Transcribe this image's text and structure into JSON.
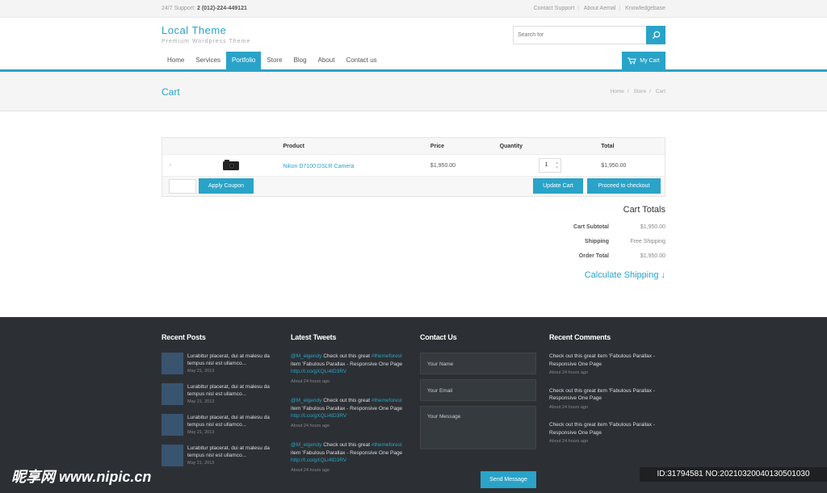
{
  "topbar": {
    "support_label": "24/7 Support:",
    "support_phone": "2 (012)-224-449121",
    "links": [
      "Contact Support",
      "About Aemal",
      "Knowledgebase"
    ]
  },
  "brand": {
    "title": "Local Theme",
    "tagline": "Premium Wordpress Theme"
  },
  "search": {
    "placeholder": "Search for"
  },
  "nav": {
    "items": [
      "Home",
      "Services",
      "Portfolio",
      "Store",
      "Blog",
      "About",
      "Contact us"
    ],
    "active": "Portfolio",
    "cart_label": "My Cart"
  },
  "page": {
    "title": "Cart",
    "breadcrumb": [
      "Home",
      "Store",
      "Cart"
    ]
  },
  "cart": {
    "headers": {
      "product": "Product",
      "price": "Price",
      "quantity": "Quantity",
      "total": "Total"
    },
    "items": [
      {
        "remove": "×",
        "product": "Nikon D7100 DSLR Camera",
        "price": "$1,950.00",
        "quantity": "1",
        "total": "$1,950.00"
      }
    ],
    "apply_coupon": "Apply Coupon",
    "update_cart": "Update Cart",
    "checkout": "Proceed to checkout"
  },
  "totals": {
    "title": "Cart Totals",
    "rows": [
      {
        "label": "Cart Subtotal",
        "value": "$1,950.00"
      },
      {
        "label": "Shipping",
        "value": "Free Shipping"
      },
      {
        "label": "Order Total",
        "value": "$1,950.00"
      }
    ],
    "calculate_shipping": "Calculate Shipping ↓"
  },
  "footer": {
    "recent_posts": {
      "title": "Recent Posts",
      "posts": [
        {
          "line1": "Lurabitur placerat, dui at malesu da",
          "line2": "tempus nisl est ullamco...",
          "date": "May 21, 2013"
        },
        {
          "line1": "Lurabitur placerat, dui at malesu da",
          "line2": "tempus nisl est ullamco...",
          "date": "May 21, 2013"
        },
        {
          "line1": "Lurabitur placerat, dui at malesu da",
          "line2": "tempus nisl est ullamco...",
          "date": "May 21, 2013"
        },
        {
          "line1": "Lurabitur placerat, dui at malesu da",
          "line2": "tempus nisl est ullamco...",
          "date": "May 21, 2013"
        }
      ]
    },
    "latest_tweets": {
      "title": "Latest Tweets",
      "tweets": [
        {
          "user": "@M_elgendy",
          "text1": " Check out this great ",
          "tag": "#themeforest",
          "text2": "item 'Fabulous Parallax - Responsive One Page",
          "link": "http://t.co/gXQLi4tD3RV",
          "when": "About 24 hours ago"
        },
        {
          "user": "@M_elgendy",
          "text1": " Check out this great ",
          "tag": "#themeforest",
          "text2": "item 'Fabulous Parallax - Responsive One Page",
          "link": "http://t.co/gXQLi4tD3RV",
          "when": "About 24 hours ago"
        },
        {
          "user": "@M_elgendy",
          "text1": " Check out this great ",
          "tag": "#themeforest",
          "text2": "item 'Fabulous Parallax - Responsive One Page",
          "link": "http://t.co/gXQLi4tD3RV",
          "when": "About 24 hours ago"
        }
      ]
    },
    "contact": {
      "title": "Contact Us",
      "name_placeholder": "Your Name",
      "email_placeholder": "Your Email",
      "message_placeholder": "Your Message",
      "send": "Send Message"
    },
    "recent_comments": {
      "title": "Recent Comments",
      "comments": [
        {
          "line1": "Check out this great item 'Fabulous Parallax -",
          "line2": "Responsive One Page",
          "when": "About 24 hours ago"
        },
        {
          "line1": "Check out this great item 'Fabulous Parallax -",
          "line2": "Responsive One Page",
          "when": "About 24 hours ago"
        },
        {
          "line1": "Check out this great item 'Fabulous Parallax -",
          "line2": "Responsive One Page",
          "when": "About 24 hours ago"
        }
      ]
    }
  },
  "watermark": {
    "left": "昵享网 www.nipic.cn",
    "right": "ID:31794581 NO:20210320040130501030"
  },
  "colors": {
    "accent": "#2aa3c8",
    "footer_bg": "#2c3034"
  }
}
